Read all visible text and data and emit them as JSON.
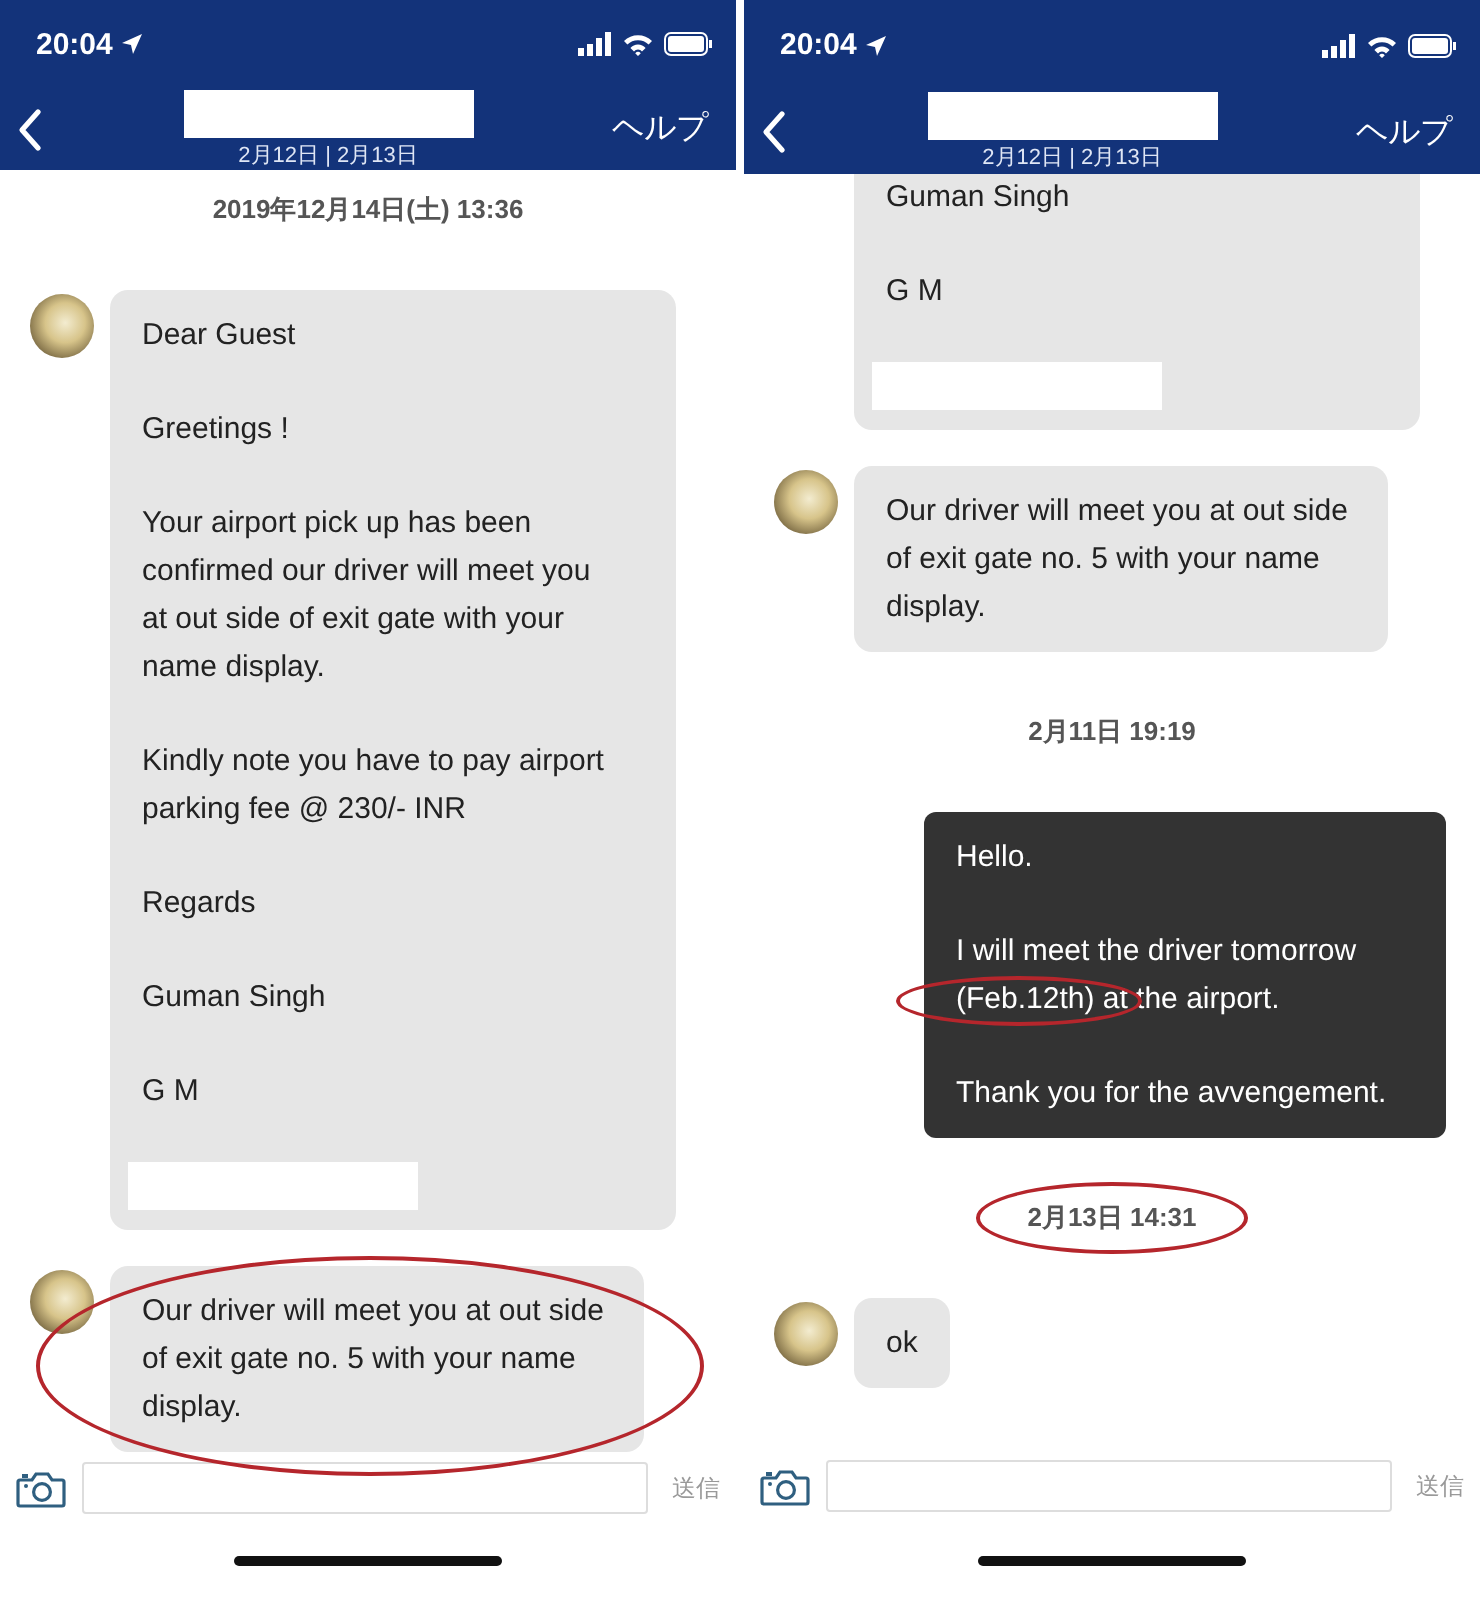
{
  "phones": [
    {
      "status_bar": {
        "time": "20:04"
      },
      "header": {
        "title_redacted": true,
        "subtitle": "2月12日 | 2月13日",
        "help": "ヘルプ"
      },
      "messages": [
        {
          "kind": "timestamp",
          "text": "2019年12月14日(土) 13:36"
        },
        {
          "kind": "incoming",
          "continued": false,
          "circled": false,
          "signature_redacted": true,
          "paragraphs": [
            "Dear Guest",
            "Greetings !",
            "Your airport pick up has been confirmed our driver will meet you at out side of exit gate with your name display.",
            "Kindly note you have to pay airport parking fee @ 230/- INR",
            "Regards",
            "Guman Singh",
            "G M"
          ]
        },
        {
          "kind": "incoming",
          "continued": false,
          "circled": true,
          "signature_redacted": false,
          "paragraphs": [
            "Our driver will meet you at out side of exit gate no. 5 with your name display."
          ]
        }
      ],
      "composer": {
        "send": "送信"
      }
    },
    {
      "status_bar": {
        "time": "20:04"
      },
      "header": {
        "title_redacted": true,
        "subtitle": "2月12日 | 2月13日",
        "help": "ヘルプ"
      },
      "messages": [
        {
          "kind": "incoming",
          "continued": true,
          "circled": false,
          "signature_redacted": true,
          "paragraphs": [
            "Guman Singh",
            "G M"
          ]
        },
        {
          "kind": "incoming",
          "continued": false,
          "circled": false,
          "signature_redacted": false,
          "paragraphs": [
            "Our driver will meet you at out side of exit gate no. 5 with your name display."
          ]
        },
        {
          "kind": "timestamp",
          "text": "2月11日 19:19"
        },
        {
          "kind": "outgoing",
          "circled": false,
          "paragraphs": [
            "Hello.",
            [
              {
                "text": "I will meet the driver tomorrow ",
                "circled": false
              },
              {
                "text": "(Feb.12th)",
                "circled": true
              },
              {
                "text": " at the airport.",
                "circled": false
              }
            ],
            "Thank you for the avvengement."
          ]
        },
        {
          "kind": "timestamp",
          "text": "2月13日 14:31",
          "circled": true
        },
        {
          "kind": "incoming",
          "continued": false,
          "circled": false,
          "signature_redacted": false,
          "paragraphs": [
            "ok"
          ]
        }
      ],
      "composer": {
        "send": "送信"
      }
    }
  ]
}
